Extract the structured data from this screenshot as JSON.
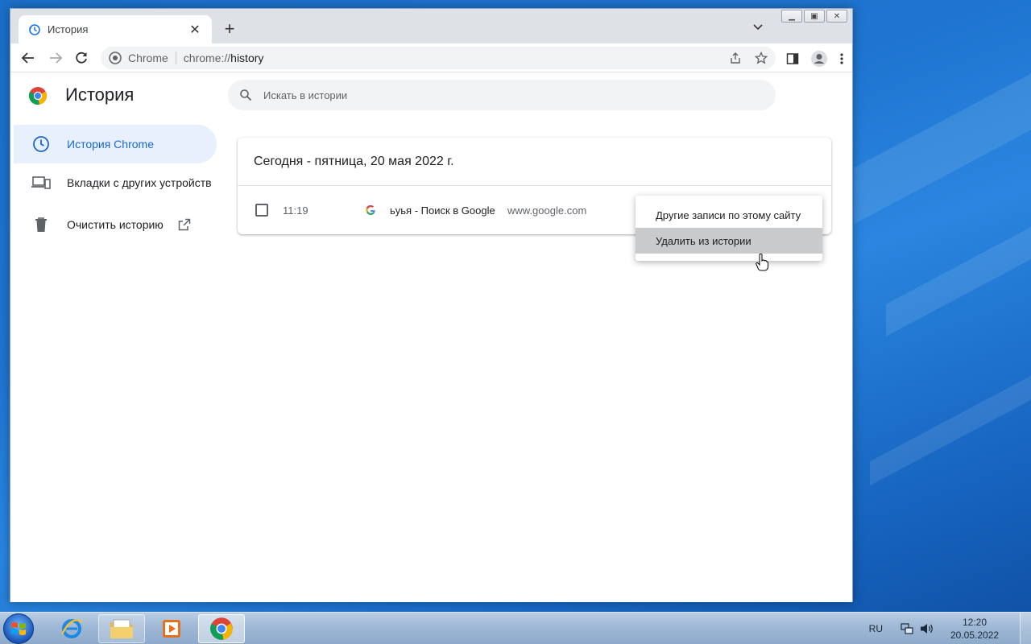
{
  "colors": {
    "accent": "#1967d2",
    "active_bg": "#e8f0fe",
    "menu_hover": "#c9cacb",
    "desktop": "#1e74d0"
  },
  "browser": {
    "tab": {
      "title": "История",
      "icon": "history-icon"
    },
    "omnibox": {
      "site_label": "Chrome",
      "url_prefix": "chrome://",
      "url_path": "history"
    }
  },
  "page": {
    "title": "История",
    "search": {
      "placeholder": "Искать в истории",
      "icon": "search-icon"
    },
    "sidebar": [
      {
        "label": "История Chrome",
        "icon": "clock-icon",
        "active": true
      },
      {
        "label": "Вкладки с других устройств",
        "icon": "devices-icon"
      },
      {
        "label": "Очистить историю",
        "icon": "trash-icon"
      }
    ],
    "history_group": {
      "heading": "Сегодня - пятница, 20 мая 2022 г.",
      "entries": [
        {
          "time": "11:19",
          "title": "ьуья - Поиск в Google",
          "domain": "www.google.com",
          "favicon": "google-icon"
        }
      ]
    },
    "context_menu": [
      {
        "label": "Другие записи по этому сайту"
      },
      {
        "label": "Удалить из истории",
        "hovered": true
      }
    ]
  },
  "taskbar": {
    "language": "RU",
    "time": "12:20",
    "date": "20.05.2022"
  }
}
